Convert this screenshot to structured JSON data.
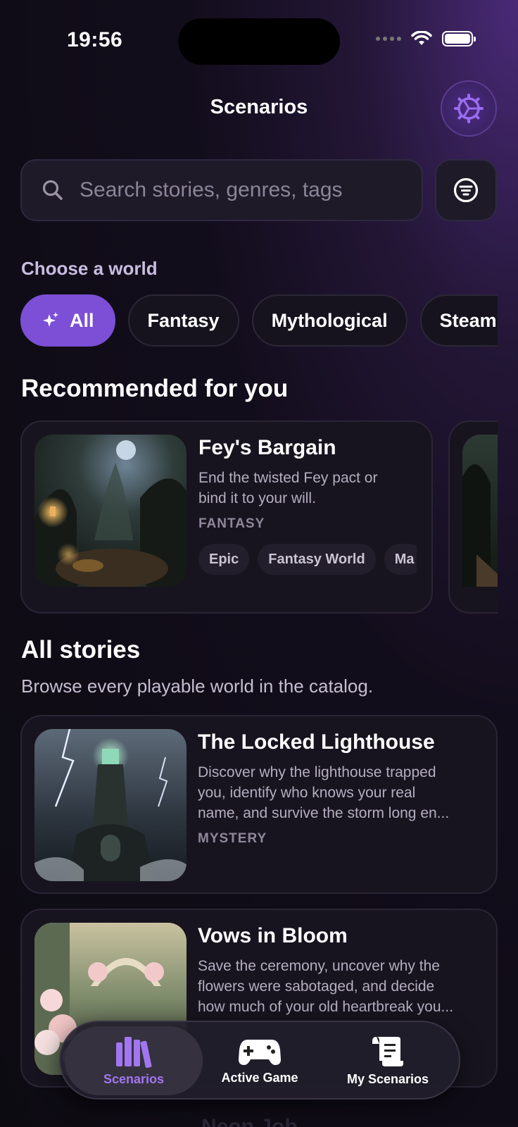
{
  "status_bar": {
    "time": "19:56"
  },
  "header": {
    "title": "Scenarios",
    "settings_icon": "settings-gear-icon"
  },
  "search": {
    "placeholder": "Search stories, genres, tags"
  },
  "worlds": {
    "label": "Choose a world",
    "chips": [
      "All",
      "Fantasy",
      "Mythological",
      "Steamp"
    ],
    "selected": "All"
  },
  "recommended": {
    "heading": "Recommended for you",
    "card": {
      "title": "Fey's Bargain",
      "description_line1": "End the twisted Fey pact or",
      "description_line2": "bind it to your will.",
      "genre": "FANTASY",
      "tags": [
        "Epic",
        "Fantasy World",
        "Ma"
      ]
    }
  },
  "all_stories": {
    "heading": "All stories",
    "subtitle": "Browse every playable world in the catalog.",
    "items": [
      {
        "title": "The Locked Lighthouse",
        "line1": "Discover why the lighthouse trapped",
        "line2": "you, identify who knows your real",
        "line3": "name, and survive the storm long en...",
        "genre": "MYSTERY"
      },
      {
        "title": "Vows in Bloom",
        "line1": "Save the ceremony, uncover why the",
        "line2": "flowers were sabotaged, and decide",
        "line3": "how much of your old heartbreak you..."
      },
      {
        "title": "Neon Job"
      }
    ]
  },
  "tabbar": {
    "tabs": [
      {
        "label": "Scenarios",
        "icon": "books-icon",
        "active": true
      },
      {
        "label": "Active Game",
        "icon": "gamepad-icon",
        "active": false
      },
      {
        "label": "My Scenarios",
        "icon": "scroll-icon",
        "active": false
      }
    ]
  },
  "colors": {
    "accent": "#7c4fd6",
    "accent_text": "#a176f0",
    "background": "#0d0b12"
  }
}
